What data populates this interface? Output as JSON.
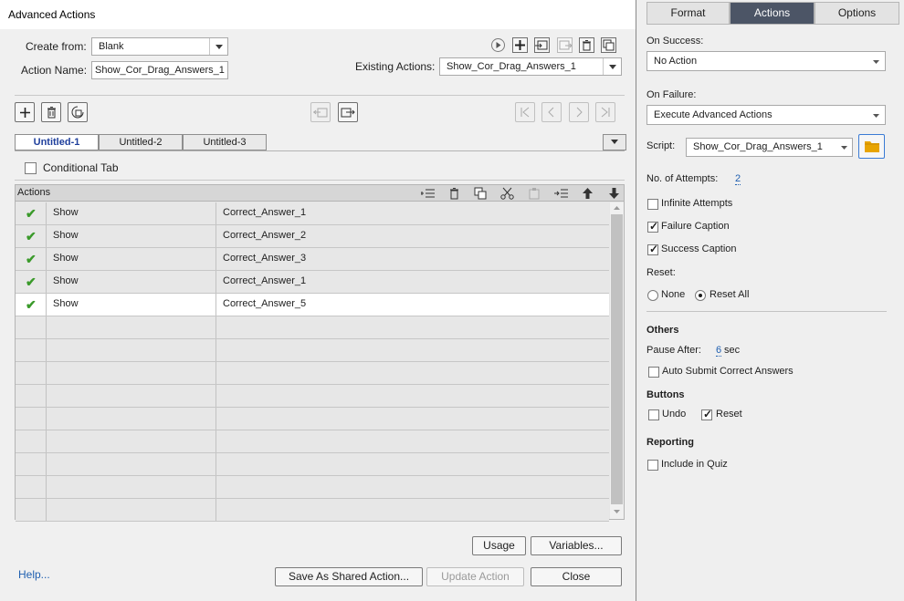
{
  "dialog": {
    "title": "Advanced Actions",
    "create_from_label": "Create from:",
    "create_from_value": "Blank",
    "action_name_label": "Action Name:",
    "action_name_value": "Show_Cor_Drag_Answers_1",
    "existing_actions_label": "Existing Actions:",
    "existing_actions_value": "Show_Cor_Drag_Answers_1",
    "tabs": [
      "Untitled-1",
      "Untitled-2",
      "Untitled-3"
    ],
    "active_tab": "Untitled-1",
    "conditional_tab_label": "Conditional Tab",
    "actions_header": "Actions",
    "rows": [
      {
        "status": "✔",
        "action": "Show",
        "target": "Correct_Answer_1"
      },
      {
        "status": "✔",
        "action": "Show",
        "target": "Correct_Answer_2"
      },
      {
        "status": "✔",
        "action": "Show",
        "target": "Correct_Answer_3"
      },
      {
        "status": "✔",
        "action": "Show",
        "target": "Correct_Answer_1"
      },
      {
        "status": "✔",
        "action": "Show",
        "target": "Correct_Answer_5"
      }
    ],
    "buttons": {
      "usage": "Usage",
      "variables": "Variables...",
      "help": "Help...",
      "save_shared": "Save As Shared Action...",
      "update": "Update Action",
      "close": "Close"
    }
  },
  "panel": {
    "tabs": [
      "Format",
      "Actions",
      "Options"
    ],
    "active_tab": "Actions",
    "on_success_label": "On Success:",
    "on_success_value": "No Action",
    "on_failure_label": "On Failure:",
    "on_failure_value": "Execute Advanced Actions",
    "script_label": "Script:",
    "script_value": "Show_Cor_Drag_Answers_1",
    "attempts_label": "No. of Attempts:",
    "attempts_value": "2",
    "infinite_attempts": "Infinite Attempts",
    "failure_caption": "Failure Caption",
    "success_caption": "Success Caption",
    "reset_label": "Reset:",
    "reset_none": "None",
    "reset_all": "Reset All",
    "others_head": "Others",
    "pause_after_label": "Pause After:",
    "pause_after_value": "6",
    "pause_after_unit": "sec",
    "auto_submit": "Auto Submit Correct Answers",
    "buttons_head": "Buttons",
    "undo": "Undo",
    "reset": "Reset",
    "reporting_head": "Reporting",
    "include_quiz": "Include in Quiz"
  },
  "colors": {
    "accent": "#4c5566",
    "link": "#1f5fb0",
    "check": "#3a9a2a",
    "folder": "#e8a400"
  }
}
